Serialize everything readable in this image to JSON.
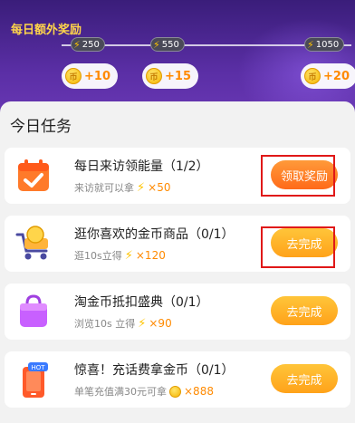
{
  "header": {
    "title": "每日额外奖励",
    "milestones": [
      {
        "threshold": "250",
        "reward": "+10"
      },
      {
        "threshold": "550",
        "reward": "+15"
      },
      {
        "threshold": "1050",
        "reward": "+20"
      }
    ]
  },
  "panel": {
    "title": "今日任务"
  },
  "tasks": [
    {
      "name": "每日来访领能量（1/2）",
      "sub": "来访就可以拿",
      "reward": "×50",
      "button": "领取奖励"
    },
    {
      "name": "逛你喜欢的金币商品（0/1）",
      "sub": "逛10s立得",
      "reward": "×120",
      "button": "去完成"
    },
    {
      "name": "淘金币抵扣盛典（0/1）",
      "sub": "浏览10s 立得",
      "reward": "×90",
      "button": "去完成"
    },
    {
      "name": "惊喜！充话费拿金币（0/1）",
      "sub": "单笔充值满30元可拿",
      "reward": "×888",
      "button": "去完成",
      "badge": "HOT"
    }
  ],
  "icons": {
    "bolt": "lightning-icon",
    "coin": "coin-icon",
    "calendar": "calendar-check-icon",
    "cart": "shopping-cart-icon",
    "bag": "shopping-bag-icon",
    "phone": "phone-icon"
  }
}
